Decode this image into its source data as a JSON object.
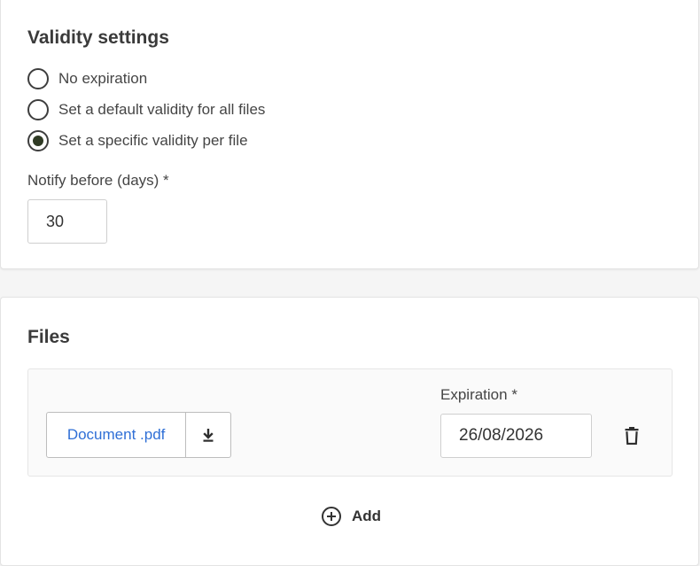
{
  "validity": {
    "title": "Validity settings",
    "options": [
      {
        "label": "No expiration",
        "selected": false
      },
      {
        "label": "Set a default validity for all files",
        "selected": false
      },
      {
        "label": "Set a specific validity per file",
        "selected": true
      }
    ],
    "notify_label": "Notify before (days) *",
    "notify_value": "30"
  },
  "files": {
    "title": "Files",
    "items": [
      {
        "name": "Document .pdf",
        "expiration_label": "Expiration *",
        "expiration_value": "26/08/2026",
        "download_icon": "download-icon",
        "delete_icon": "trash-icon"
      }
    ],
    "add_label": "Add",
    "add_icon": "plus-circle-icon"
  },
  "colors": {
    "link": "#2f6fd6",
    "radio_selected": "#2f3a24",
    "text": "#454545"
  }
}
